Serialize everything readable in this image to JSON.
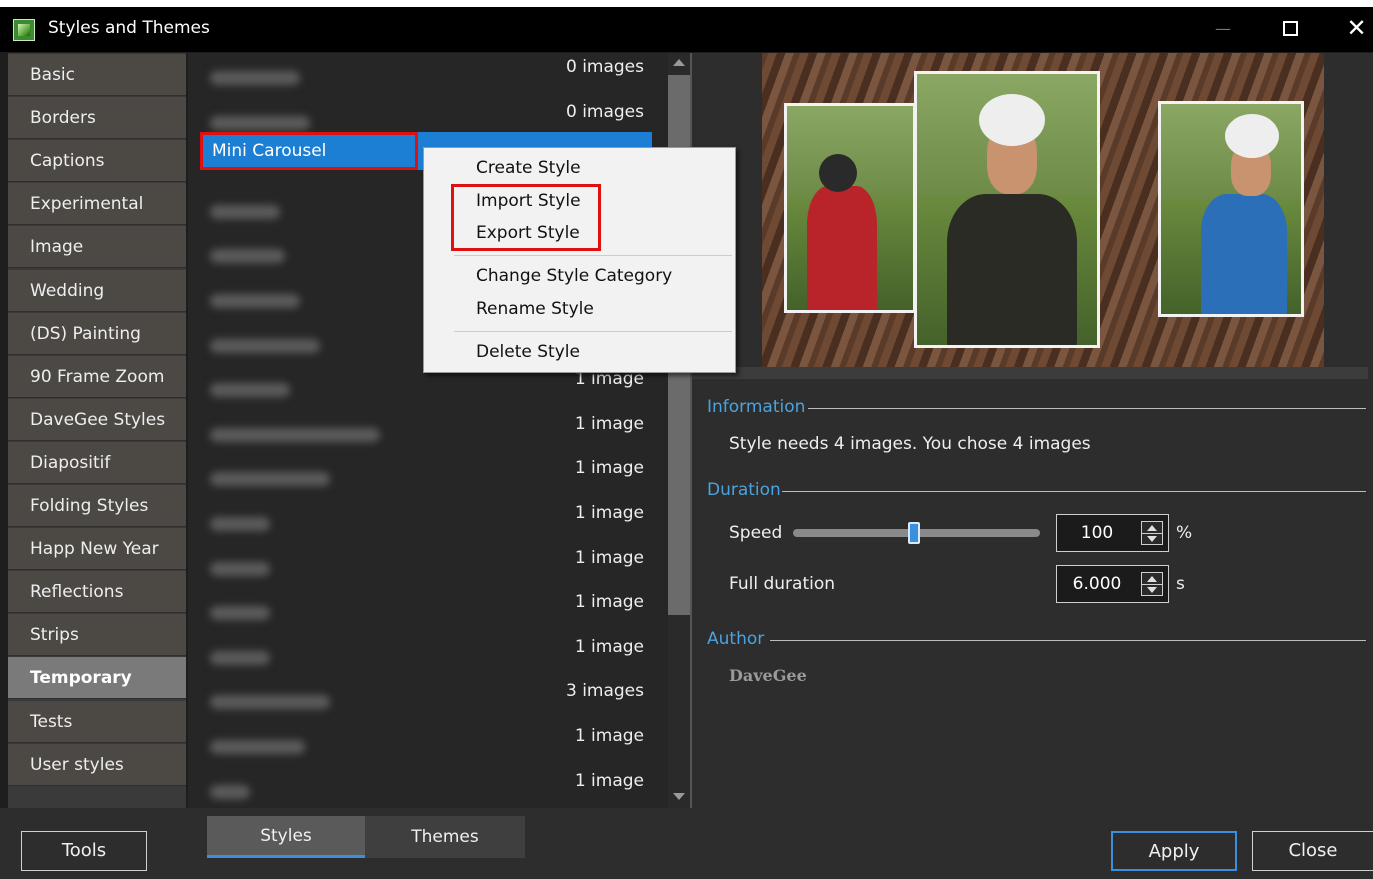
{
  "window": {
    "title": "Styles and Themes",
    "min_glyph": "—",
    "close_glyph": "✕"
  },
  "categories": [
    {
      "label": "Basic"
    },
    {
      "label": "Borders"
    },
    {
      "label": "Captions"
    },
    {
      "label": "Experimental"
    },
    {
      "label": "Image"
    },
    {
      "label": "Wedding"
    },
    {
      "label": "(DS) Painting"
    },
    {
      "label": "90 Frame Zoom"
    },
    {
      "label": "DaveGee Styles"
    },
    {
      "label": "Diapositif"
    },
    {
      "label": "Folding Styles"
    },
    {
      "label": "Happ New Year"
    },
    {
      "label": "Reflections"
    },
    {
      "label": "Strips"
    },
    {
      "label": "Temporary",
      "active": true
    },
    {
      "label": "Tests"
    },
    {
      "label": "User styles"
    }
  ],
  "styles_list": {
    "selected_label": "Mini Carousel",
    "rows": [
      {
        "count": "0 images"
      },
      {
        "count": "0 images"
      },
      {
        "count": ""
      },
      {
        "count": ""
      },
      {
        "count": ""
      },
      {
        "count": ""
      },
      {
        "count": ""
      },
      {
        "count": "1 image"
      },
      {
        "count": "1 image"
      },
      {
        "count": "1 image"
      },
      {
        "count": "1 image"
      },
      {
        "count": "1 image"
      },
      {
        "count": "1 image"
      },
      {
        "count": "1 image"
      },
      {
        "count": "3 images"
      },
      {
        "count": "1 image"
      },
      {
        "count": "1 image"
      }
    ]
  },
  "context_menu": {
    "create": "Create Style",
    "import": "Import Style",
    "export": "Export Style",
    "change_category": "Change Style Category",
    "rename": "Rename Style",
    "delete": "Delete Style"
  },
  "info": {
    "information_head": "Information",
    "information_text": "Style needs 4 images. You chose 4 images",
    "duration_head": "Duration",
    "speed_label": "Speed",
    "speed_value": "100",
    "speed_unit": "%",
    "speed_fraction": 0.49,
    "full_duration_label": "Full duration",
    "full_duration_value": "6.000",
    "full_duration_unit": "s",
    "author_head": "Author",
    "author_name": "DaveGee"
  },
  "bottom": {
    "tools": "Tools",
    "tab_styles": "Styles",
    "tab_themes": "Themes",
    "apply": "Apply",
    "close": "Close"
  },
  "colors": {
    "accent": "#3b8ee0",
    "selection": "#1d7fd4",
    "highlight_box": "#e01010"
  }
}
